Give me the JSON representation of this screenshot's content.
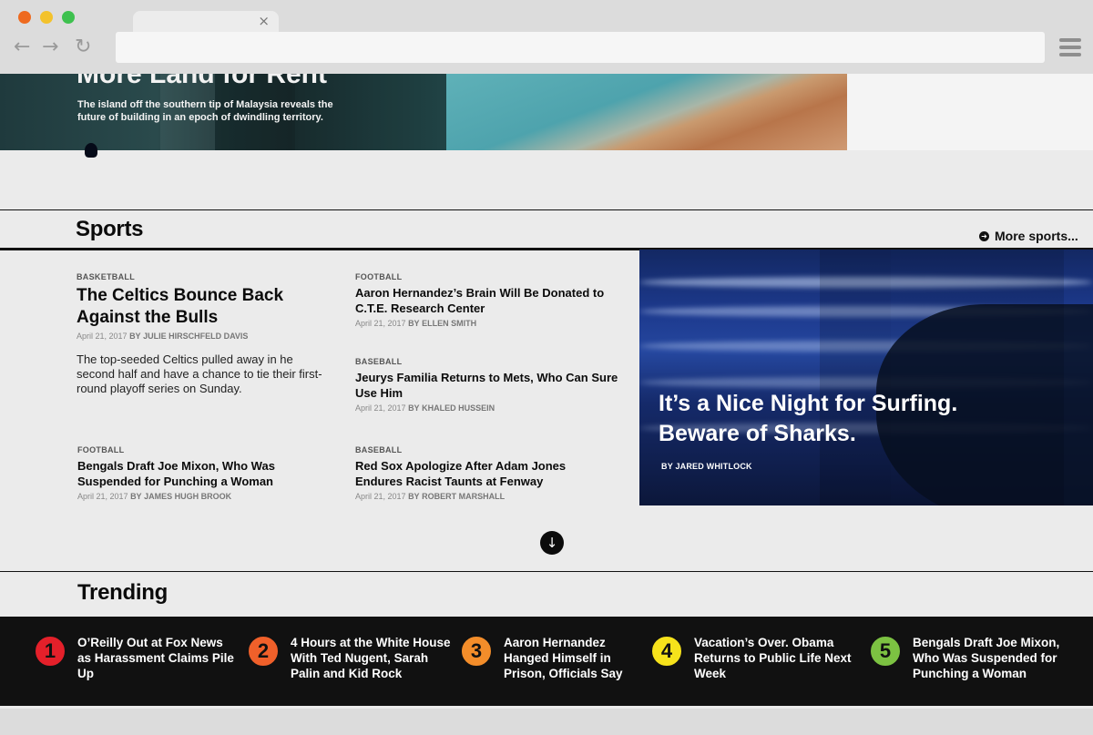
{
  "browser": {
    "tab_close": "×",
    "url": ""
  },
  "hero": {
    "title": "More Land for Rent",
    "dek": "The island off the southern tip of Malaysia reveals the future of building in an epoch of dwindling territory."
  },
  "sports": {
    "title": "Sports",
    "more_label": "More sports...",
    "articles": [
      {
        "kicker": "BASKETBALL",
        "headline": "The Celtics Bounce Back Against the Bulls",
        "date": "April 21, 2017",
        "by": "BY",
        "author": "JULIE HIRSCHFELD DAVIS",
        "dek": "The top-seeded Celtics pulled away in he second half and have a chance to tie their first-round playoff series on Sunday."
      },
      {
        "kicker": "FOOTBALL",
        "headline": "Aaron Hernandez’s Brain Will Be Donated to C.T.E. Research Center",
        "date": "April 21, 2017",
        "by": "BY",
        "author": "ELLEN SMITH"
      },
      {
        "kicker": "BASEBALL",
        "headline": "Jeurys Familia Returns to Mets, Who Can Sure Use Him",
        "date": "April 21, 2017",
        "by": "BY",
        "author": "KHALED HUSSEIN"
      },
      {
        "kicker": "FOOTBALL",
        "headline": "Bengals Draft Joe Mixon, Who Was Suspended for Punching a Woman",
        "date": "April 21, 2017",
        "by": "BY",
        "author": "JAMES HUGH BROOK"
      },
      {
        "kicker": "BASEBALL",
        "headline": "Red Sox Apologize After Adam Jones Endures Racist Taunts at Fenway",
        "date": "April 21, 2017",
        "by": "BY",
        "author": "ROBERT MARSHALL"
      }
    ],
    "feature": {
      "title": "It’s a Nice Night for Surfing. Beware of Sharks.",
      "byline": "BY JARED WHITLOCK"
    }
  },
  "trending": {
    "title": "Trending",
    "items": [
      {
        "rank": "1",
        "text": "O’Reilly Out at Fox News as Harassment Claims Pile Up",
        "color": "#e4202a"
      },
      {
        "rank": "2",
        "text": "4 Hours at the White House With Ted Nugent, Sarah Palin and Kid Rock",
        "color": "#f0602a"
      },
      {
        "rank": "3",
        "text": "Aaron Hernandez Hanged Himself in Prison, Officials Say",
        "color": "#f38d2a"
      },
      {
        "rank": "4",
        "text": "Vacation’s Over. Obama Returns to Public Life Next Week",
        "color": "#f6e21b"
      },
      {
        "rank": "5",
        "text": "Bengals Draft Joe Mixon, Who Was Suspended for Punching a Woman",
        "color": "#7cc242"
      }
    ]
  },
  "icons": {
    "back": "back-arrow-icon",
    "forward": "forward-arrow-icon",
    "reload": "reload-icon",
    "menu": "hamburger-menu-icon",
    "more": "circle-arrow-right-icon",
    "down": "circle-arrow-down-icon"
  }
}
